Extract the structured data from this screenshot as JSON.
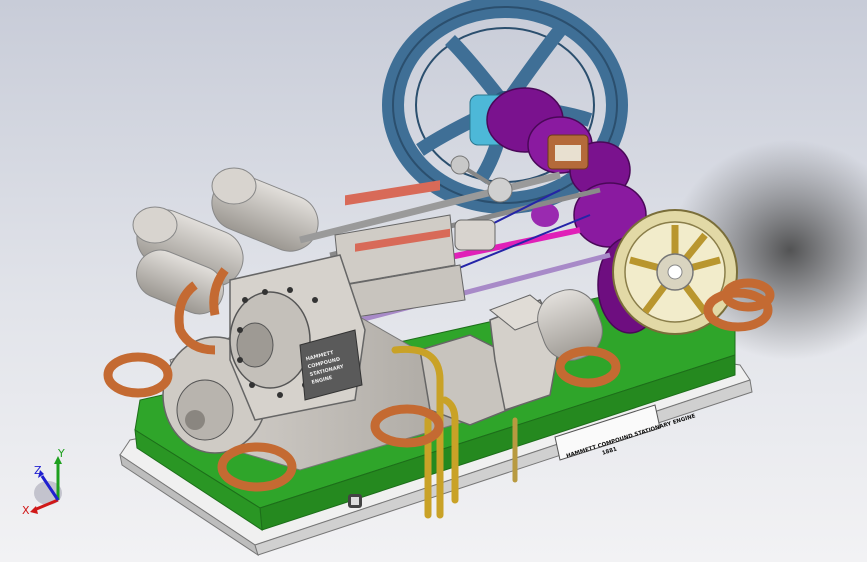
{
  "viewport": {
    "name": "3D model viewport",
    "background_top": "#c8ccd8",
    "background_bottom": "#f2f2f4"
  },
  "model": {
    "colors": {
      "base_plate": "#e8e8e8",
      "green_bed": "#2fa52a",
      "cylinder_metal": "#c4c0bb",
      "flywheel": "#3f6f96",
      "purple_parts": "#7a128e",
      "copper_rings": "#c46a32",
      "brass_pipes": "#c9a227",
      "pink_rod": "#e020b8",
      "small_wheel": "#e2d9a6"
    },
    "nameplate": {
      "line1": "HAMMETT COMPOUND STATIONARY ENGINE",
      "line2": "1881"
    },
    "cylinder_plate": {
      "line1": "HAMMETT",
      "line2": "COMPOUND",
      "line3": "STATIONARY",
      "line4": "ENGINE"
    }
  },
  "triad": {
    "x_label": "X",
    "y_label": "Y",
    "z_label": "Z",
    "x_color": "#d01818",
    "y_color": "#1ea01e",
    "z_color": "#2020d0"
  }
}
